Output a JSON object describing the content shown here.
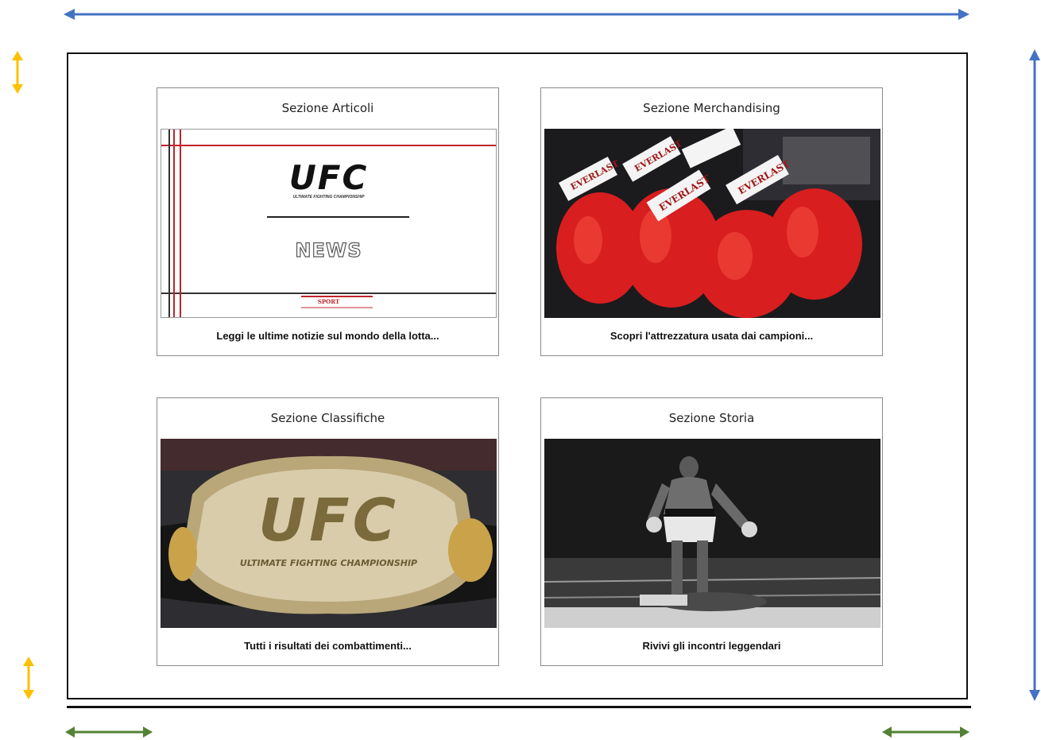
{
  "cards": [
    {
      "title": "Sezione Articoli",
      "caption": "Leggi le ultime notizie sul mondo della lotta...",
      "image": {
        "brand": "UFC",
        "brand_sub": "ULTIMATE FIGHTING CHAMPIONSHIP",
        "word": "NEWS",
        "tag": "SPORT"
      }
    },
    {
      "title": "Sezione Merchandising",
      "caption": "Scopri l'attrezzatura usata dai campioni...",
      "image": {
        "glove_label": "EVERLAST"
      }
    },
    {
      "title": "Sezione Classifiche",
      "caption": "Tutti i risultati dei combattimenti...",
      "image": {
        "belt_text": "UFC",
        "belt_sub": "ULTIMATE FIGHTING CHAMPIONSHIP"
      }
    },
    {
      "title": "Sezione Storia",
      "caption": "Rivivi gli incontri leggendari",
      "image": {}
    }
  ],
  "colors": {
    "blue_arrow": "#4472c4",
    "orange_arrow": "#ffc000",
    "green_arrow": "#548235",
    "ufc_red": "#c0232c",
    "glove_red": "#d81e1e"
  }
}
